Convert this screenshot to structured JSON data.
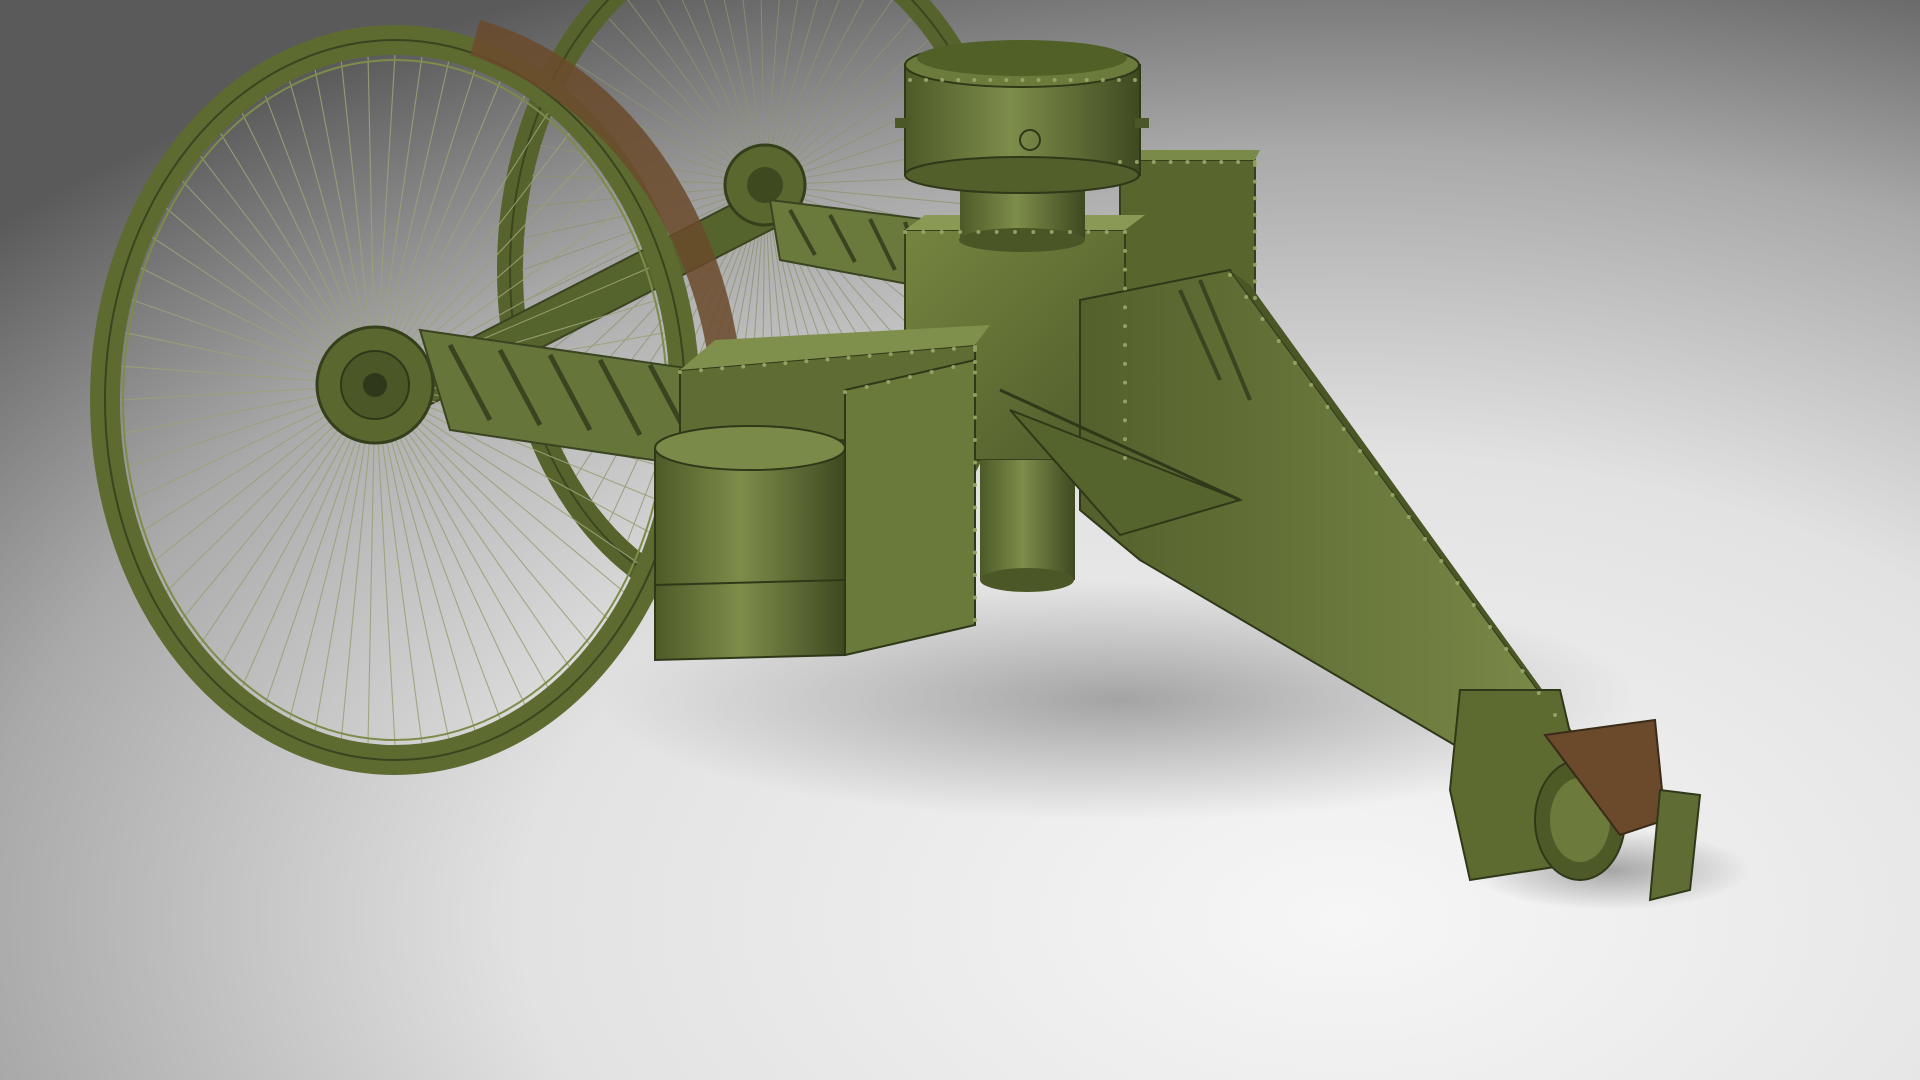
{
  "scene": {
    "subject": "tsar-tank-3d-render",
    "colors": {
      "hull": "#5f6d36",
      "hull_light": "#7a8a4a",
      "hull_dark": "#3f4a22",
      "rim_brown": "#6b4a2c",
      "spoke": "#9aa278",
      "background_light": "#f4f4f4",
      "background_dark": "#5e5e5e",
      "shadow": "#8a8a8a"
    },
    "spoke_count": 64
  }
}
